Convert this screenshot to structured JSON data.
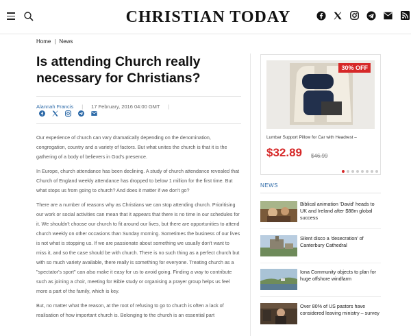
{
  "header": {
    "logo": "CHRISTIAN TODAY",
    "social_icons": [
      "facebook-icon",
      "x-icon",
      "instagram-icon",
      "telegram-icon",
      "email-icon",
      "rss-icon"
    ]
  },
  "breadcrumb": {
    "home": "Home",
    "section": "News",
    "separator": "|"
  },
  "article": {
    "title": "Is attending Church really necessary for Christians?",
    "author": "Alannah Francis",
    "separator": "|",
    "date": "17 February, 2016 04:00 GMT",
    "paragraphs": [
      "Our experience of church can vary dramatically depending on the denomination, congregation, country and a variety of factors. But what unites the church is that it is the gathering of a body of believers in God's presence.",
      "In Europe, church attendance has been declining. A study of church attendance revealed that Church of England weekly attendance has dropped to below 1 million for the first time. But what stops us from going to church? And does it matter if we don't go?",
      "There are a number of reasons why as Christians we can stop attending church. Prioritising our work or social activities can mean that it appears that there is no time in our schedules for it. We shouldn't choose our church to fit around our lives, but there are opportunities to attend church weekly on other occasions than Sunday morning. Sometimes the business of our lives is not what is stopping us. If we are passionate about something we usually don't want to miss it, and so the case should be with church. There is no such thing as a perfect church but with so much variety available, there really is something for everyone. Treating church as a \"spectator's sport\" can also make it easy for us to avoid going. Finding a way to contribute such as joining a choir, meeting for Bible study or organising a prayer group helps us feel more a part of the family, which is key.",
      "But, no matter what the reason, at the root of refusing to go to church is often a lack of realisation of how important church is. Belonging to the church is an essential part"
    ]
  },
  "ad": {
    "badge": "30% OFF",
    "product": "Lumbar Support Pillow for Car with Headrest –",
    "price": "$32.89",
    "old_price": "$46.99",
    "active_dot": 1,
    "dot_count": 8,
    "colors": {
      "accent": "#d62828"
    }
  },
  "news": {
    "heading": "NEWS",
    "items": [
      {
        "title": "Biblical animation 'David' heads to UK and Ireland after $88m global success"
      },
      {
        "title": "Silent disco a 'desecration' of Canterbury Cathedral"
      },
      {
        "title": "Iona Community objects to plan for huge offshore windfarm"
      },
      {
        "title": "Over 80% of US pastors have considered leaving ministry – survey"
      }
    ]
  },
  "colors": {
    "link": "#2d6aa8",
    "text": "#333333"
  }
}
